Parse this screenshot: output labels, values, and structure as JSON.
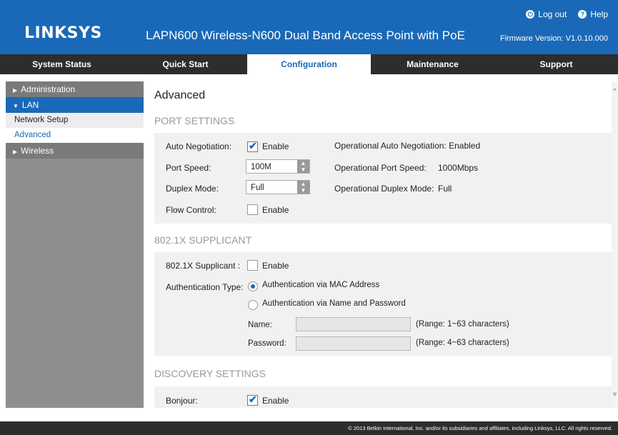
{
  "header": {
    "logo": "LINKSYS",
    "product": "LAPN600 Wireless-N600 Dual Band Access Point with PoE",
    "logout": "Log out",
    "help": "Help",
    "firmware": "Firmware Version: V1.0.10.000"
  },
  "nav": {
    "tabs": [
      {
        "label": "System Status"
      },
      {
        "label": "Quick Start"
      },
      {
        "label": "Configuration"
      },
      {
        "label": "Maintenance"
      },
      {
        "label": "Support"
      }
    ],
    "active": "Configuration"
  },
  "sidebar": {
    "administration": "Administration",
    "lan": "LAN",
    "network_setup": "Network Setup",
    "advanced": "Advanced",
    "wireless": "Wireless"
  },
  "page": {
    "title": "Advanced"
  },
  "port_settings": {
    "title": "PORT SETTINGS",
    "auto_neg_label": "Auto Negotiation:",
    "auto_neg_enable": "Enable",
    "auto_neg_checked": true,
    "op_auto_neg": "Operational Auto Negotiation: Enabled",
    "port_speed_label": "Port Speed:",
    "port_speed_value": "100M",
    "op_port_speed_label": "Operational Port Speed:",
    "op_port_speed_value": "1000Mbps",
    "duplex_label": "Duplex Mode:",
    "duplex_value": "Full",
    "op_duplex_label": "Operational Duplex Mode:",
    "op_duplex_value": "Full",
    "flow_label": "Flow Control:",
    "flow_enable": "Enable",
    "flow_checked": false
  },
  "supplicant": {
    "title": "802.1X SUPPLICANT",
    "label": "802.1X Supplicant :",
    "enable": "Enable",
    "checked": false,
    "auth_type_label": "Authentication Type:",
    "auth_mac": "Authentication via MAC Address",
    "auth_name": "Authentication via Name and Password",
    "selected": "mac",
    "name_label": "Name:",
    "name_value": "",
    "name_hint": "(Range: 1~63 characters)",
    "password_label": "Password:",
    "password_value": "",
    "password_hint": "(Range: 4~63 characters)"
  },
  "discovery": {
    "title": "DISCOVERY SETTINGS",
    "bonjour_label": "Bonjour:",
    "bonjour_enable": "Enable",
    "bonjour_checked": true
  },
  "footer": {
    "text": "© 2013 Belkin International, Inc. and/or its subsidiaries and affiliates, including Linksys, LLC. All rights reserved."
  },
  "colors": {
    "brand_blue": "#1a69b8",
    "nav_dark": "#2d2d2d",
    "sidebar_gray": "#8e8e8e"
  }
}
